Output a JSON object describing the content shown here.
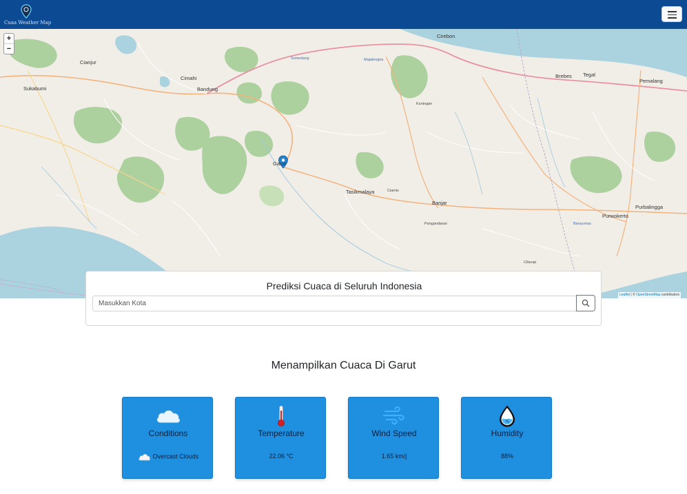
{
  "navbar": {
    "brand_text": "Cuaa Weather Map",
    "menu_icon": "hamburger-icon"
  },
  "map": {
    "zoom_in": "+",
    "zoom_out": "−",
    "attribution_leaflet": "Leaflet",
    "attribution_sep": " | © ",
    "attribution_osm": "OpenStreetMap",
    "attribution_tail": " contributors",
    "marker_icon": "map-marker-icon",
    "labels": {
      "bandung": "Bandung",
      "cimahi": "Cimahi",
      "garut": "Garut",
      "tasikmalaya": "Tasikmalaya",
      "cirebon": "Cirebon",
      "sumedang": "Sumedang",
      "majalengka": "Majalengka",
      "kuningan": "Kuningan",
      "banjar": "Banjar",
      "purwokerto": "Purwokerto",
      "purbalingga": "Purbalingga",
      "brebes": "Brebes",
      "tegal": "Tegal",
      "pemalang": "Pemalang",
      "cianjur": "Cianjur",
      "sukabumi": "Sukabumi",
      "ciamis": "Ciamis",
      "pangandaran": "Pangandaran",
      "cilacap": "Cilacap",
      "banyumas": "Banyumas"
    }
  },
  "search": {
    "title": "Prediksi Cuaca di Seluruh Indonesia",
    "placeholder": "Masukkan Kota",
    "button_icon": "search-icon"
  },
  "result": {
    "heading": "Menampilkan Cuaca Di Garut"
  },
  "cards": [
    {
      "title": "Conditions",
      "value": "Overcast Clouds",
      "icon": "cloud-icon"
    },
    {
      "title": "Temperature",
      "value": "22.06 °C",
      "icon": "thermometer-icon"
    },
    {
      "title": "Wind Speed",
      "value": "1.65 km/j",
      "icon": "wind-icon"
    },
    {
      "title": "Humidity",
      "value": "88%",
      "icon": "humidity-drop-icon"
    }
  ],
  "colors": {
    "navbar": "#0d4a94",
    "card": "#1f8fe0",
    "sea": "#aad3df",
    "forest": "#add19e"
  }
}
